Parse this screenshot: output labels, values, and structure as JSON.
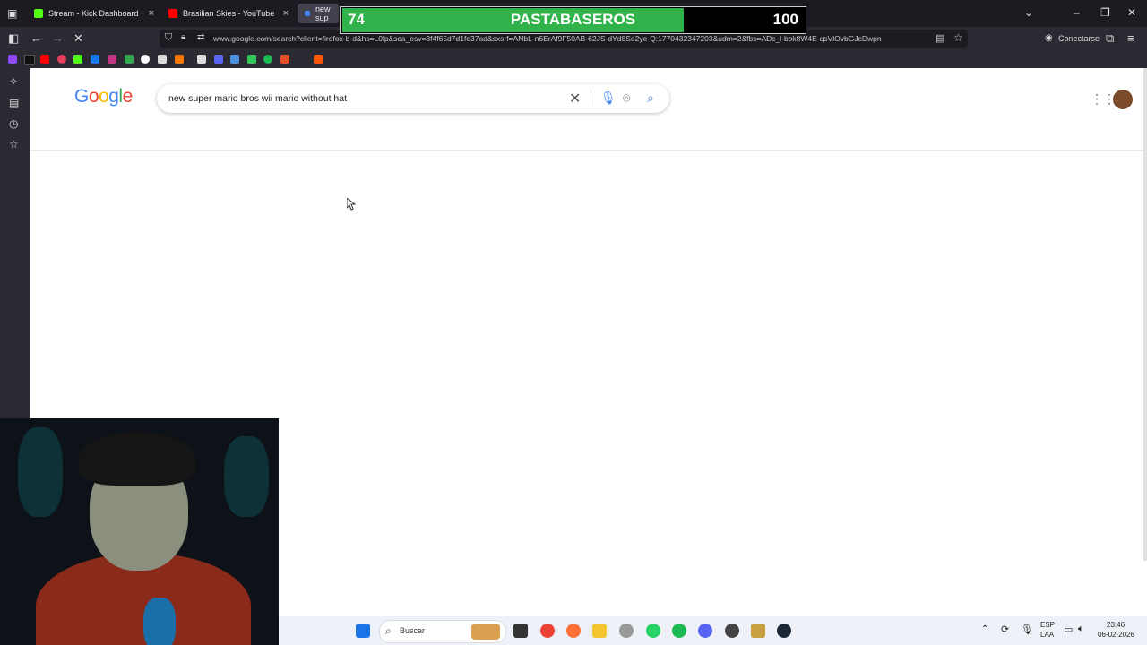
{
  "tabs": [
    {
      "label": "Stream - Kick Dashboard",
      "color": "#53fc18"
    },
    {
      "label": "Brasilian Skies - YouTube",
      "color": "#ff0000"
    },
    {
      "label": "new sup",
      "color": "#4285f4"
    }
  ],
  "new_tab_label": "+",
  "address_bar": {
    "url": "www.google.com/search?client=firefox-b-d&hs=L0lp&sca_esv=3f4f65d7d1fe37ad&sxsrf=ANbL-n6ErAf9F50AB-62JS-dYd8So2ye-Q:1770432347203&udm=2&fbs=ADc_l-bpk8W4E-qsVlOvbGJcDwpn"
  },
  "account_label": "Conectarse",
  "google": {
    "logo": "Google",
    "query": "new super mario bros wii mario without hat"
  },
  "overlay": {
    "left_value": "74",
    "title": "PASTABASEROS",
    "right_value": "100",
    "progress": 0.74
  },
  "taskbar": {
    "search_label": "Buscar",
    "lang_top": "ESP",
    "lang_bottom": "LAA",
    "time": "23:46",
    "date": "06-02-2026"
  }
}
